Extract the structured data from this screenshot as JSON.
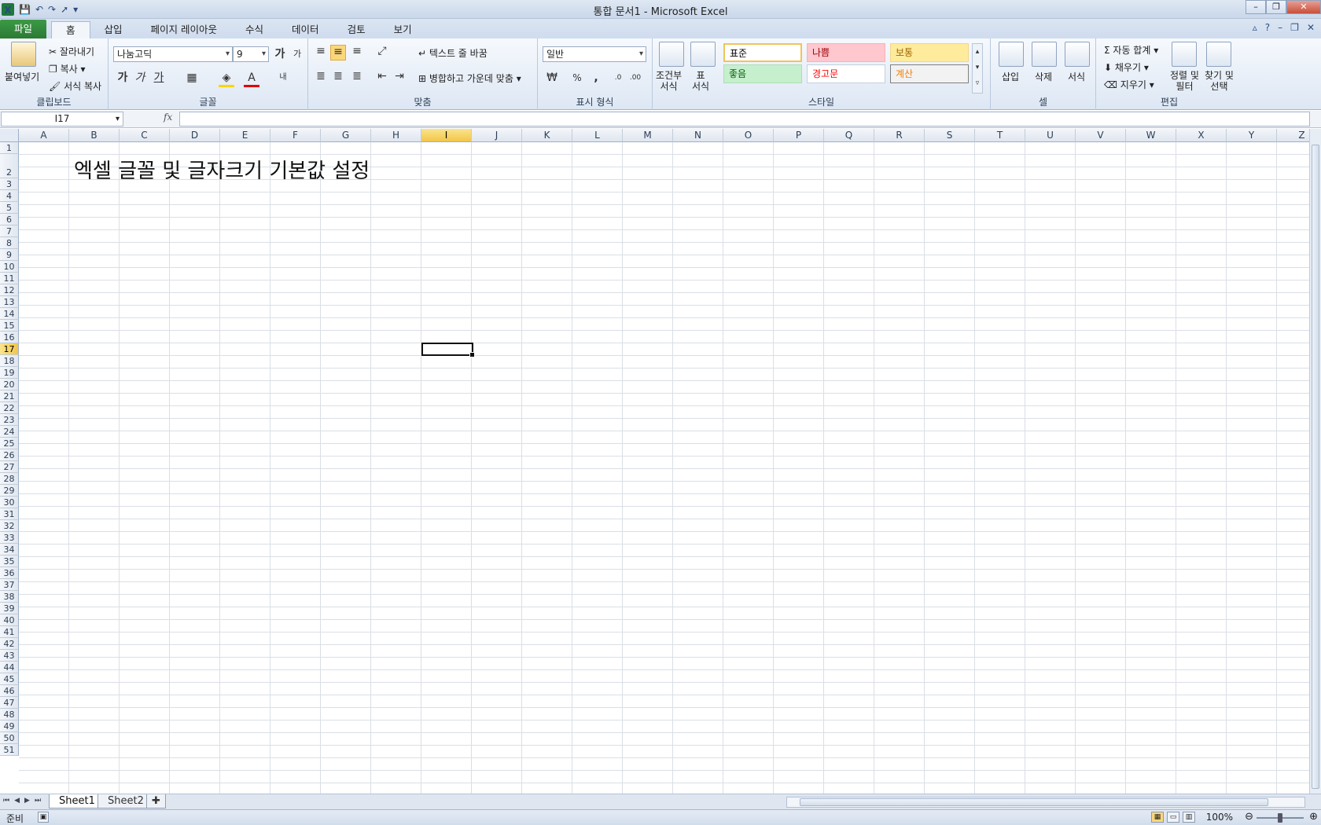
{
  "window": {
    "title": "통합 문서1 - Microsoft Excel",
    "minimize": "–",
    "restore": "❐",
    "close": "✕"
  },
  "qat": {
    "app": "X",
    "save": "💾",
    "undo": "↶",
    "redo": "↷",
    "pointer": "➚",
    "customize": "▾"
  },
  "tabs": [
    {
      "label": "파일"
    },
    {
      "label": "홈"
    },
    {
      "label": "삽입"
    },
    {
      "label": "페이지 레이아웃"
    },
    {
      "label": "수식"
    },
    {
      "label": "데이터"
    },
    {
      "label": "검토"
    },
    {
      "label": "보기"
    }
  ],
  "tabs_right": {
    "collapse": "▵",
    "help": "?",
    "min": "–",
    "restore": "❐",
    "close": "✕"
  },
  "ribbon": {
    "clipboard": {
      "paste": "붙여넣기",
      "cut": "잘라내기",
      "copy": "복사",
      "format_painter": "서식 복사",
      "label": "클립보드"
    },
    "font": {
      "name": "나눔고딕",
      "size": "9",
      "grow": "가",
      "shrink": "가",
      "bold": "가",
      "italic": "가",
      "underline": "가",
      "label": "글꼴"
    },
    "alignment": {
      "wrap": "텍스트 줄 바꿈",
      "merge": "병합하고 가운데 맞춤",
      "label": "맞춤"
    },
    "number": {
      "format": "일반",
      "percent": "%",
      "comma": ",",
      "label": "표시 형식"
    },
    "styles": {
      "conditional": "조건부\n서식",
      "table": "표\n서식",
      "cells": [
        {
          "label": "표준",
          "bg": "#ffffff",
          "fg": "#000000",
          "border": "#f2c25a"
        },
        {
          "label": "나쁨",
          "bg": "#ffc7ce",
          "fg": "#9c0006",
          "border": "#f5b3bc"
        },
        {
          "label": "보통",
          "bg": "#ffeb9c",
          "fg": "#9c6500",
          "border": "#f1d789"
        },
        {
          "label": "좋음",
          "bg": "#c6efce",
          "fg": "#006100",
          "border": "#aedcb8"
        },
        {
          "label": "경고문",
          "bg": "#ffffff",
          "fg": "#ff0000",
          "border": "#c3cfdd"
        },
        {
          "label": "계산",
          "bg": "#f2f2f2",
          "fg": "#fa7d00",
          "border": "#7f7f7f"
        }
      ],
      "label": "스타일"
    },
    "cells": {
      "insert": "삽입",
      "delete": "삭제",
      "format": "서식",
      "label": "셀"
    },
    "editing": {
      "autosum": "자동 합계",
      "fill": "채우기",
      "clear": "지우기",
      "sort": "정렬 및\n필터",
      "find": "찾기 및\n선택",
      "label": "편집"
    }
  },
  "formula_bar": {
    "name_box": "I17",
    "fx": "fx",
    "content": ""
  },
  "columns": [
    "A",
    "B",
    "C",
    "D",
    "E",
    "F",
    "G",
    "H",
    "I",
    "J",
    "K",
    "L",
    "M",
    "N",
    "O",
    "P",
    "Q",
    "R",
    "S",
    "T",
    "U",
    "V",
    "W",
    "X",
    "Y",
    "Z"
  ],
  "selected_column": "I",
  "selected_row": 17,
  "row_count": 51,
  "cell_b2": "엑셀 글꼴 및 글자크기 기본값 설정",
  "sheets": [
    {
      "label": "Sheet1",
      "active": true
    },
    {
      "label": "Sheet2",
      "active": false
    }
  ],
  "status": {
    "ready": "준비",
    "zoom": "100%",
    "zoom_level": 0.5
  }
}
